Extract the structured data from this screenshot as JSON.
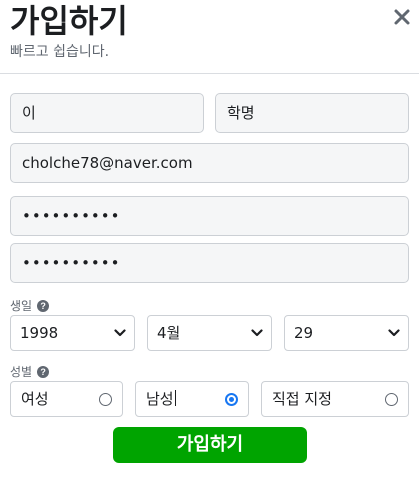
{
  "header": {
    "title": "가입하기",
    "subtitle": "빠르고 쉽습니다.",
    "close_icon": "close-icon"
  },
  "form": {
    "last_name_value": "이",
    "first_name_value": "학명",
    "email_value": "cholche78@naver.com",
    "password_value": "••••••••••",
    "password_confirm_value": "••••••••••"
  },
  "birthday": {
    "label": "생일",
    "help_icon": "help-icon",
    "year_value": "1998",
    "month_value": "4월",
    "day_value": "29"
  },
  "gender": {
    "label": "성별",
    "help_icon": "help-icon",
    "options": [
      {
        "label": "여성",
        "checked": false
      },
      {
        "label": "남성",
        "checked": true
      },
      {
        "label": "직접 지정",
        "checked": false
      }
    ]
  },
  "submit": {
    "label": "가입하기"
  },
  "colors": {
    "accent": "#1877f2",
    "submit_green": "#00a400",
    "field_bg": "#f5f6f7",
    "border": "#ccd0d5"
  }
}
